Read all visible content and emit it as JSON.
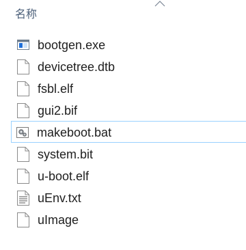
{
  "header": {
    "name_column": "名称",
    "sort_icon": "chevron-up-icon"
  },
  "files": [
    {
      "name": "bootgen.exe",
      "icon": "exe-app-icon"
    },
    {
      "name": "devicetree.dtb",
      "icon": "blank-file-icon"
    },
    {
      "name": "fsbl.elf",
      "icon": "blank-file-icon"
    },
    {
      "name": "gui2.bif",
      "icon": "blank-file-icon"
    },
    {
      "name": "makeboot.bat",
      "icon": "batch-gear-file-icon",
      "selected": true
    },
    {
      "name": "system.bit",
      "icon": "blank-file-icon"
    },
    {
      "name": "u-boot.elf",
      "icon": "blank-file-icon"
    },
    {
      "name": "uEnv.txt",
      "icon": "text-file-icon"
    },
    {
      "name": "uImage",
      "icon": "blank-file-icon"
    }
  ],
  "colors": {
    "header_text": "#4c607a",
    "selection_border": "#99d1ff",
    "exe_accent": "#1e6fd9"
  }
}
